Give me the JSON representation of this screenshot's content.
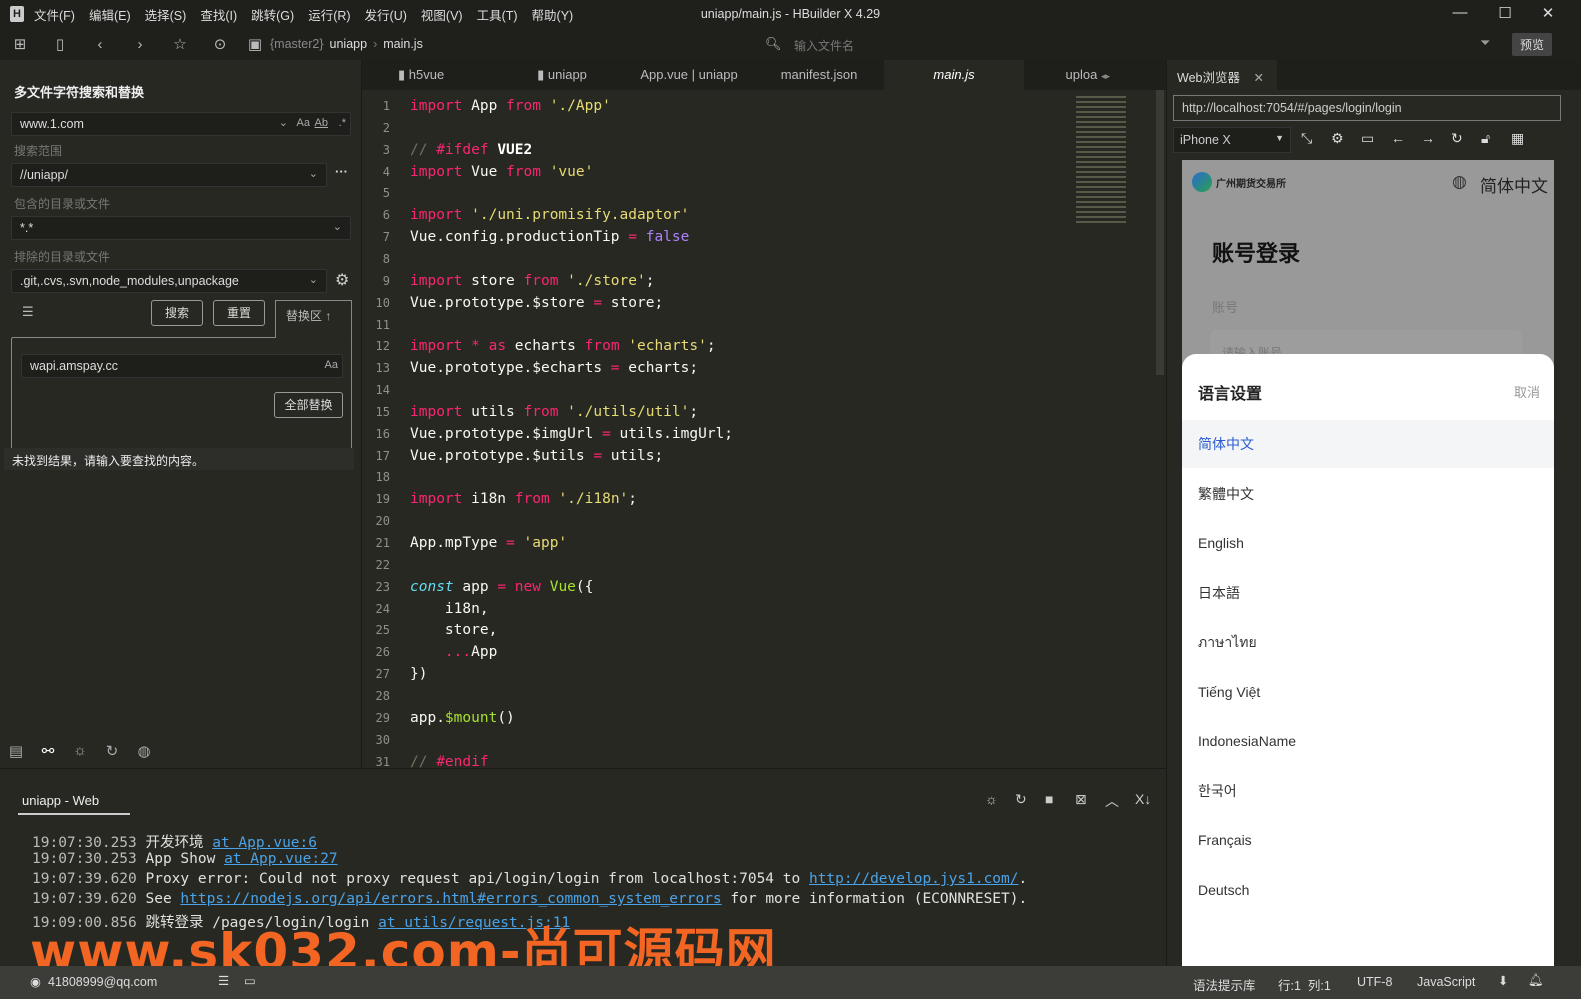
{
  "app": {
    "title": "uniapp/main.js - HBuilder X 4.29",
    "logo": "H",
    "menu": [
      "文件(F)",
      "编辑(E)",
      "选择(S)",
      "查找(I)",
      "跳转(G)",
      "运行(R)",
      "发行(U)",
      "视图(V)",
      "工具(T)",
      "帮助(Y)"
    ]
  },
  "toolbar": {
    "breadcrumb": [
      "{master2}",
      "uniapp",
      "main.js"
    ],
    "file_search_placeholder": "输入文件名",
    "preview_label": "预览"
  },
  "search_panel": {
    "title": "多文件字符搜索和替换",
    "search_value": "www.1.com",
    "scope_label": "搜索范围",
    "scope_value": "//uniapp/",
    "include_label": "包含的目录或文件",
    "include_value": "*.*",
    "exclude_label": "排除的目录或文件",
    "exclude_value": ".git,.cvs,.svn,node_modules,unpackage",
    "search_btn": "搜索",
    "reset_btn": "重置",
    "replace_tab": "替换区 ↑",
    "replace_value": "wapi.amspay.cc",
    "replace_all_btn": "全部替换",
    "result": "未找到结果，请输入要查找的内容。",
    "case_icon": "Aa",
    "word_icon": "Ab",
    "regex_icon": ".*"
  },
  "editor": {
    "tabs": [
      "h5vue",
      "uniapp",
      "App.vue | uniapp",
      "manifest.json",
      "main.js",
      "uploa"
    ],
    "active_tab": 4,
    "lines": [
      [
        [
          "k",
          "import"
        ],
        [
          "p",
          " App "
        ],
        [
          "k",
          "from"
        ],
        [
          "p",
          " "
        ],
        [
          "s",
          "'./App'"
        ]
      ],
      [],
      [
        [
          "c",
          "// "
        ],
        [
          "k",
          "#ifdef"
        ],
        [
          "p",
          " "
        ],
        [
          "b",
          "VUE2"
        ]
      ],
      [
        [
          "k",
          "import"
        ],
        [
          "p",
          " Vue "
        ],
        [
          "k",
          "from"
        ],
        [
          "p",
          " "
        ],
        [
          "s",
          "'vue'"
        ]
      ],
      [],
      [
        [
          "k",
          "import"
        ],
        [
          "p",
          " "
        ],
        [
          "s",
          "'./uni.promisify.adaptor'"
        ]
      ],
      [
        [
          "p",
          "Vue.config.productionTip "
        ],
        [
          "k",
          "="
        ],
        [
          "p",
          " "
        ],
        [
          "v",
          "false"
        ]
      ],
      [],
      [
        [
          "k",
          "import"
        ],
        [
          "p",
          " store "
        ],
        [
          "k",
          "from"
        ],
        [
          "p",
          " "
        ],
        [
          "s",
          "'./store'"
        ],
        [
          "p",
          ";"
        ]
      ],
      [
        [
          "p",
          "Vue.prototype.$store "
        ],
        [
          "k",
          "="
        ],
        [
          "p",
          " store;"
        ]
      ],
      [],
      [
        [
          "k",
          "import"
        ],
        [
          "p",
          " "
        ],
        [
          "k",
          "*"
        ],
        [
          "p",
          " "
        ],
        [
          "k",
          "as"
        ],
        [
          "p",
          " echarts "
        ],
        [
          "k",
          "from"
        ],
        [
          "p",
          " "
        ],
        [
          "s",
          "'echarts'"
        ],
        [
          "p",
          ";"
        ]
      ],
      [
        [
          "p",
          "Vue.prototype.$echarts "
        ],
        [
          "k",
          "="
        ],
        [
          "p",
          " echarts;"
        ]
      ],
      [],
      [
        [
          "k",
          "import"
        ],
        [
          "p",
          " utils "
        ],
        [
          "k",
          "from"
        ],
        [
          "p",
          " "
        ],
        [
          "s",
          "'./utils/util'"
        ],
        [
          "p",
          ";"
        ]
      ],
      [
        [
          "p",
          "Vue.prototype.$imgUrl "
        ],
        [
          "k",
          "="
        ],
        [
          "p",
          " utils.imgUrl;"
        ]
      ],
      [
        [
          "p",
          "Vue.prototype.$utils "
        ],
        [
          "k",
          "="
        ],
        [
          "p",
          " utils;"
        ]
      ],
      [],
      [
        [
          "k",
          "import"
        ],
        [
          "p",
          " i18n "
        ],
        [
          "k",
          "from"
        ],
        [
          "p",
          " "
        ],
        [
          "s",
          "'./i18n'"
        ],
        [
          "p",
          ";"
        ]
      ],
      [],
      [
        [
          "p",
          "App.mpType "
        ],
        [
          "k",
          "="
        ],
        [
          "p",
          " "
        ],
        [
          "s",
          "'app'"
        ]
      ],
      [],
      [
        [
          "i",
          "const"
        ],
        [
          "p",
          " app "
        ],
        [
          "k",
          "="
        ],
        [
          "p",
          " "
        ],
        [
          "k",
          "new"
        ],
        [
          "p",
          " "
        ],
        [
          "f",
          "Vue"
        ],
        [
          "p",
          "({"
        ]
      ],
      [
        [
          "p",
          "    i18n,"
        ]
      ],
      [
        [
          "p",
          "    store,"
        ]
      ],
      [
        [
          "p",
          "    "
        ],
        [
          "k",
          "..."
        ],
        [
          "p",
          "App"
        ]
      ],
      [
        [
          "p",
          "})"
        ]
      ],
      [],
      [
        [
          "p",
          "app."
        ],
        [
          "f",
          "$mount"
        ],
        [
          "p",
          "()"
        ]
      ],
      [],
      [
        [
          "c",
          "// "
        ],
        [
          "k",
          "#endif"
        ]
      ]
    ]
  },
  "browser": {
    "tab": "Web浏览器",
    "url": "http://localhost:7054/#/pages/login/login",
    "device": "iPhone X",
    "page": {
      "brand": "广州期货交易所",
      "lang_current": "简体中文",
      "heading": "账号登录",
      "account_label": "账号",
      "account_placeholder": "请输入账号"
    },
    "sheet": {
      "title": "语言设置",
      "cancel": "取消",
      "selected": 0,
      "options": [
        "简体中文",
        "繁體中文",
        "English",
        "日本語",
        "ภาษาไทย",
        "Tiếng Việt",
        "IndonesiaName",
        "한국어",
        "Français",
        "Deutsch"
      ]
    }
  },
  "console": {
    "tab": "uniapp - Web",
    "logs": [
      {
        "ts": "19:07:30.253",
        "parts": [
          [
            "t",
            " 开发环境 "
          ],
          [
            "a",
            "at App.vue:6"
          ]
        ]
      },
      {
        "ts": "19:07:30.253",
        "parts": [
          [
            "t",
            " App Show "
          ],
          [
            "a",
            "at App.vue:27"
          ]
        ]
      },
      {
        "ts": "19:07:39.620",
        "parts": [
          [
            "t",
            " Proxy error: Could not proxy request api/login/login from localhost:7054 to "
          ],
          [
            "a",
            "http://develop.jys1.com/"
          ],
          [
            "t",
            "."
          ]
        ]
      },
      {
        "ts": "19:07:39.620",
        "parts": [
          [
            "t",
            " See "
          ],
          [
            "a",
            "https://nodejs.org/api/errors.html#errors_common_system_errors"
          ],
          [
            "t",
            " for more information (ECONNRESET)."
          ]
        ]
      },
      {
        "ts": "19:09:00.856",
        "parts": [
          [
            "t",
            " 跳转登录 /pages/login/login "
          ],
          [
            "a",
            "at utils/request.js:11"
          ]
        ]
      }
    ]
  },
  "status": {
    "user": "41808999@qq.com",
    "syntax": "语法提示库",
    "position": "行:1  列:1",
    "encoding": "UTF-8",
    "language": "JavaScript"
  },
  "watermark": "www.sk032.com-尚可源码网",
  "colors": {
    "keyword": "#f92672",
    "string": "#e6db74",
    "comment": "#75715e",
    "constant": "#ae81ff",
    "link": "#4aa3e8",
    "selected_lang": "#2b5ccf",
    "watermark": "#f26522"
  }
}
